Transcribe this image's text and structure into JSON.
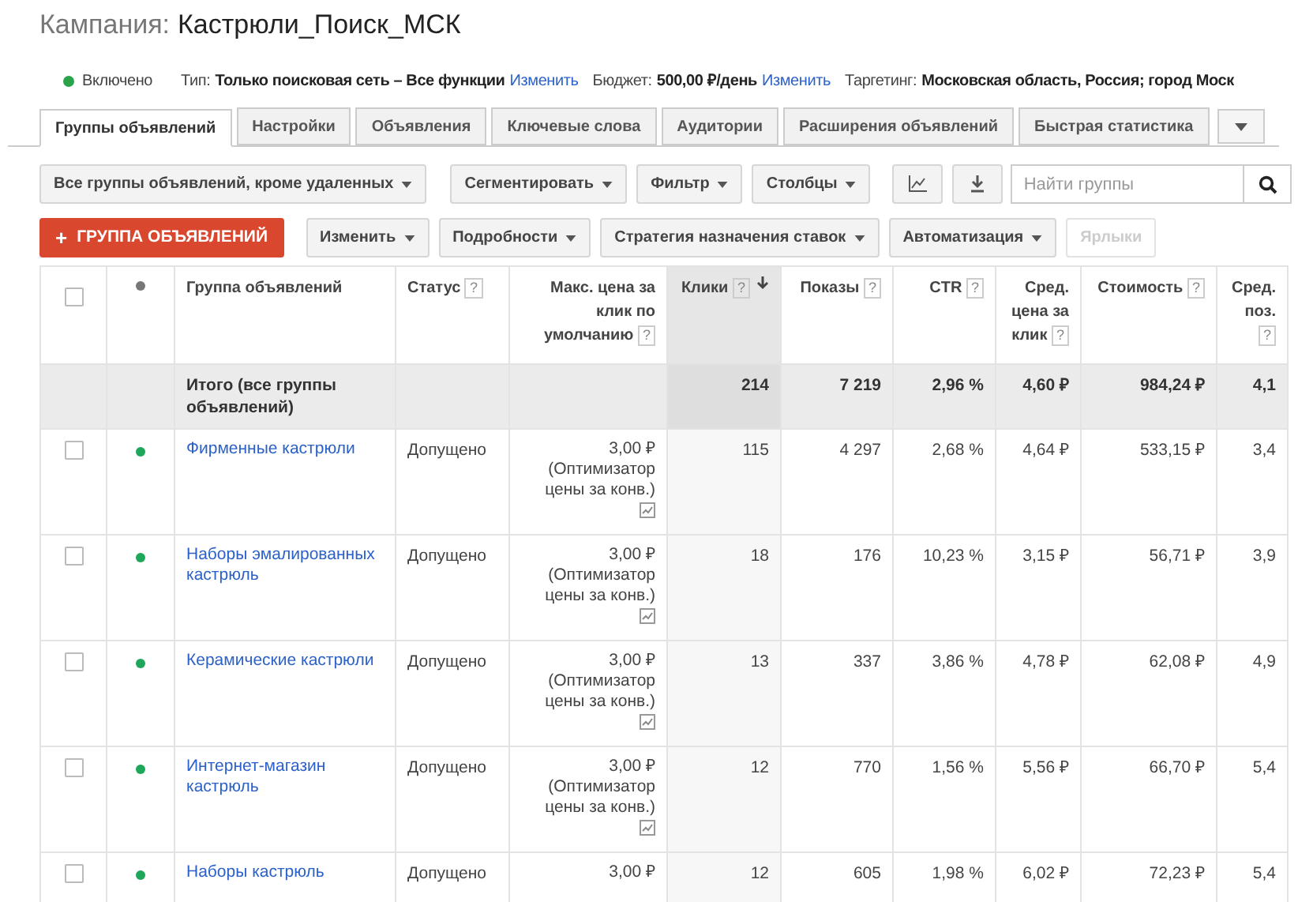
{
  "campaign": {
    "label": "Кампания:",
    "name": "Кастрюли_Поиск_МСК"
  },
  "summary": {
    "status": {
      "text": "Включено",
      "enabled": true
    },
    "items": [
      {
        "label": "Тип:",
        "value": "Только поисковая сеть – Все функции",
        "link": "Изменить"
      },
      {
        "label": "Бюджет:",
        "value": "500,00 ₽/день",
        "link": "Изменить"
      },
      {
        "label": "Таргетинг:",
        "value": "Московская область, Россия; город Моск"
      }
    ]
  },
  "tabs": [
    {
      "label": "Группы объявлений",
      "selected": true
    },
    {
      "label": "Настройки",
      "selected": false
    },
    {
      "label": "Объявления",
      "selected": false
    },
    {
      "label": "Ключевые слова",
      "selected": false
    },
    {
      "label": "Аудитории",
      "selected": false
    },
    {
      "label": "Расширения объявлений",
      "selected": false
    },
    {
      "label": "Быстрая статистика",
      "selected": false
    }
  ],
  "toolbar": {
    "view_filter": "Все группы объявлений, кроме удаленных",
    "buttons": [
      "Сегментировать",
      "Фильтр",
      "Столбцы"
    ],
    "search": {
      "placeholder": "Найти группы"
    }
  },
  "actions": {
    "primary": {
      "icon": "+",
      "label": "ГРУППА ОБЪЯВЛЕНИЙ"
    },
    "buttons": [
      {
        "label": "Изменить",
        "disabled": false
      },
      {
        "label": "Подробности",
        "disabled": false
      },
      {
        "label": "Стратегия назначения ставок",
        "disabled": false
      },
      {
        "label": "Автоматизация",
        "disabled": false
      },
      {
        "label": "Ярлыки",
        "disabled": true
      }
    ]
  },
  "table": {
    "columns": [
      {
        "kind": "checkbox",
        "sorted": false
      },
      {
        "kind": "dot",
        "sorted": false
      },
      {
        "kind": "text",
        "label": "Группа объявлений",
        "sorted": false
      },
      {
        "kind": "text",
        "label": "Статус",
        "help": "?",
        "sorted": false
      },
      {
        "kind": "num",
        "label": "Макс. цена за клик по умолчанию",
        "help": "?",
        "sorted": false
      },
      {
        "kind": "num",
        "label": "Клики",
        "help": "?",
        "sorted": true
      },
      {
        "kind": "num",
        "label": "Показы",
        "help": "?",
        "sorted": false
      },
      {
        "kind": "num",
        "label": "CTR",
        "help": "?",
        "sorted": false
      },
      {
        "kind": "num",
        "label": "Сред. цена за клик",
        "help": "?",
        "sorted": false
      },
      {
        "kind": "num",
        "label": "Стоимость",
        "help": "?",
        "sorted": false
      },
      {
        "kind": "num",
        "label": "Сред. поз.",
        "help": "?",
        "sorted": false
      }
    ],
    "total": {
      "label": "Итого (все группы объявлений)",
      "values": [
        "214",
        "7 219",
        "2,96 %",
        "4,60 ₽",
        "984,24 ₽",
        "4,1"
      ]
    },
    "rows": [
      {
        "name": "Фирменные кастрюли",
        "enabled": true,
        "checked": false,
        "status": "Допущено",
        "bid": "3,00 ₽",
        "bid_note": "(Оптимизатор цены за конв.)",
        "values": [
          "115",
          "4 297",
          "2,68 %",
          "4,64 ₽",
          "533,15 ₽",
          "3,4"
        ]
      },
      {
        "name": "Наборы эмалированных кастрюль",
        "enabled": true,
        "checked": false,
        "status": "Допущено",
        "bid": "3,00 ₽",
        "bid_note": "(Оптимизатор цены за конв.)",
        "values": [
          "18",
          "176",
          "10,23 %",
          "3,15 ₽",
          "56,71 ₽",
          "3,9"
        ]
      },
      {
        "name": "Керамические кастрюли",
        "enabled": true,
        "checked": false,
        "status": "Допущено",
        "bid": "3,00 ₽",
        "bid_note": "(Оптимизатор цены за конв.)",
        "values": [
          "13",
          "337",
          "3,86 %",
          "4,78 ₽",
          "62,08 ₽",
          "4,9"
        ]
      },
      {
        "name": "Интернет-магазин кастрюль",
        "enabled": true,
        "checked": false,
        "status": "Допущено",
        "bid": "3,00 ₽",
        "bid_note": "(Оптимизатор цены за конв.)",
        "values": [
          "12",
          "770",
          "1,56 %",
          "5,56 ₽",
          "66,70 ₽",
          "5,4"
        ]
      },
      {
        "name": "Наборы кастрюль",
        "enabled": true,
        "checked": false,
        "status": "Допущено",
        "bid": "3,00 ₽",
        "values": [
          "12",
          "605",
          "1,98 %",
          "6,02 ₽",
          "72,23 ₽",
          "5,4"
        ]
      }
    ]
  }
}
